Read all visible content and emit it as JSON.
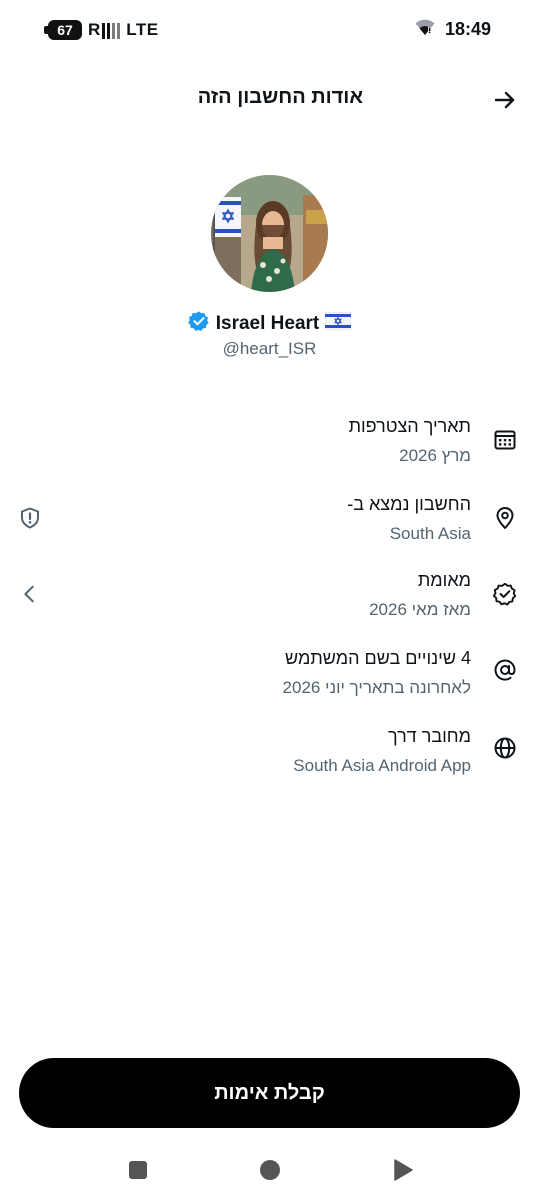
{
  "status_bar": {
    "battery_level": "67",
    "signal_letter": "R",
    "network": "LTE",
    "time": "18:49",
    "wifi_icon": "wifi-icon"
  },
  "header": {
    "title": "אודות החשבון הזה",
    "back_icon": "arrow-right-icon"
  },
  "profile": {
    "display_name": "Israel Heart",
    "flag": "🇮🇱",
    "handle": "@heart_ISR",
    "verified_color": "#1d9bf0"
  },
  "info_rows": [
    {
      "icon": "calendar-icon",
      "title": "תאריך הצטרפות",
      "subtitle": "מרץ 2026"
    },
    {
      "icon": "location-pin-icon",
      "title": "החשבון נמצא ב-",
      "subtitle": "South Asia",
      "side_icon": "shield-alert-icon"
    },
    {
      "icon": "verified-badge-icon",
      "title": "מאומת",
      "subtitle": "מאז מאי 2026",
      "side_icon": "chevron-left-icon"
    },
    {
      "icon": "at-sign-icon",
      "title": "4 שינויים בשם המשתמש",
      "subtitle": "לאחרונה בתאריך יוני 2026"
    },
    {
      "icon": "globe-icon",
      "title": "מחובר דרך",
      "subtitle": "South Asia Android App"
    }
  ],
  "cta": {
    "label": "קבלת אימות"
  },
  "nav_bar": {
    "recents_icon": "square-icon",
    "home_icon": "circle-icon",
    "back_icon": "triangle-icon"
  }
}
